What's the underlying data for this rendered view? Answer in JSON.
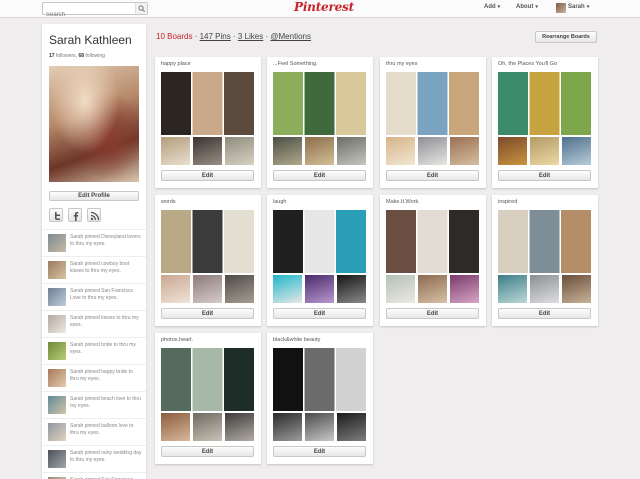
{
  "topbar": {
    "search_placeholder": "Search",
    "logo": "Pinterest",
    "add_label": "Add",
    "about_label": "About",
    "user_label": "Sarah",
    "caret": "▾"
  },
  "profile": {
    "name": "Sarah Kathleen",
    "followers_count": "17",
    "followers_label": "followers,",
    "following_count": "68",
    "following_label": "following",
    "edit_profile_label": "Edit Profile"
  },
  "header": {
    "boards_link": "10 Boards",
    "pins_link": "147 Pins",
    "likes_link": "3 Likes",
    "mentions_link": "@Mentions",
    "separator": "·",
    "rearrange_label": "Rearrange Boards"
  },
  "activity": [
    {
      "text": "Sarah pinned Disneyland lovers to thru my eyes.",
      "colors": [
        "#7d8b8f",
        "#c7b9a6"
      ]
    },
    {
      "text": "Sarah pinned cowboy boot kisses to thru my eyes.",
      "colors": [
        "#9b7b5e",
        "#d8c3a5"
      ]
    },
    {
      "text": "Sarah pinned San Francisco Love to thru my eyes.",
      "colors": [
        "#6d7f95",
        "#c1ccd6"
      ]
    },
    {
      "text": "Sarah pinned kisses to thru my eyes.",
      "colors": [
        "#b3a9a0",
        "#eeeae4"
      ]
    },
    {
      "text": "Sarah pinned bride to thru my eyes.",
      "colors": [
        "#6e8a3a",
        "#b9cc74"
      ]
    },
    {
      "text": "Sarah pinned happy bride to thru my eyes.",
      "colors": [
        "#a57858",
        "#e6ccb0"
      ]
    },
    {
      "text": "Sarah pinned beach love to thru my eyes.",
      "colors": [
        "#5f8b9a",
        "#d3c4a7"
      ]
    },
    {
      "text": "Sarah pinned balloon love to thru my eyes.",
      "colors": [
        "#8f96a0",
        "#e2d3c0"
      ]
    },
    {
      "text": "Sarah pinned rainy wedding day to thru my eyes.",
      "colors": [
        "#4b5057",
        "#a3a7ad"
      ]
    },
    {
      "text": "Sarah pinned San Francisco City H... to thru my eyes.",
      "colors": [
        "#9a8d7c",
        "#dfd6c8"
      ]
    }
  ],
  "boards": [
    {
      "title": "happy place",
      "edit_label": "Edit",
      "cover": [
        "#2c2622",
        "#caa98b",
        "#5b4a3e"
      ],
      "thumbs": [
        [
          "#b49c7c",
          "#e9dfcf"
        ],
        [
          "#3a3430",
          "#9a8f84"
        ],
        [
          "#8e8a7c",
          "#d6d2c4"
        ]
      ]
    },
    {
      "title": "...Feel Something.",
      "edit_label": "Edit",
      "cover": [
        "#8cae5a",
        "#3f6a3c",
        "#d8c89a"
      ],
      "thumbs": [
        [
          "#4a4f45",
          "#b2aa8c"
        ],
        [
          "#8b6e4a",
          "#d3bf97"
        ],
        [
          "#6b6e66",
          "#c6c6bd"
        ]
      ]
    },
    {
      "title": "thru my eyes",
      "edit_label": "Edit",
      "cover": [
        "#e5dccb",
        "#7aa3c2",
        "#c9a67c"
      ],
      "thumbs": [
        [
          "#d7b48a",
          "#f1e6d2"
        ],
        [
          "#8d8f97",
          "#e9e6e1"
        ],
        [
          "#9a7052",
          "#d6bea1"
        ]
      ]
    },
    {
      "title": "Oh, the Places You'll Go",
      "edit_label": "Edit",
      "cover": [
        "#3c8c6b",
        "#c7a33f",
        "#7da74a"
      ],
      "thumbs": [
        [
          "#7b4a2c",
          "#c9933f"
        ],
        [
          "#b39a63",
          "#ecd9a6"
        ],
        [
          "#4d6f8d",
          "#b7ccd9"
        ]
      ]
    },
    {
      "title": "words",
      "edit_label": "Edit",
      "cover": [
        "#b9a987",
        "#3b3b3b",
        "#e4dfd3"
      ],
      "thumbs": [
        [
          "#c9a791",
          "#efe3d7"
        ],
        [
          "#8c7b79",
          "#d6cccb"
        ],
        [
          "#4e4a45",
          "#a69e93"
        ]
      ]
    },
    {
      "title": "laugh",
      "edit_label": "Edit",
      "cover": [
        "#1f1f1f",
        "#e6e6e6",
        "#2b9fb8"
      ],
      "thumbs": [
        [
          "#20b7c9",
          "#e7e7e7"
        ],
        [
          "#4b2a6b",
          "#b999cf"
        ],
        [
          "#161616",
          "#8a8a8a"
        ]
      ]
    },
    {
      "title": "Make.It.Work.",
      "edit_label": "Edit",
      "cover": [
        "#6a4e42",
        "#e2dcd3",
        "#2e2a28"
      ],
      "thumbs": [
        [
          "#b4c2b6",
          "#ece9e1"
        ],
        [
          "#8b6a4f",
          "#d7c1a6"
        ],
        [
          "#7b3a6b",
          "#d6a6c6"
        ]
      ]
    },
    {
      "title": "inspired",
      "edit_label": "Edit",
      "cover": [
        "#d9cfc0",
        "#7d8e96",
        "#b58d67"
      ],
      "thumbs": [
        [
          "#3d7d88",
          "#bdd9d8"
        ],
        [
          "#8b8f94",
          "#dedfe0"
        ],
        [
          "#6a4f3a",
          "#c9b29a"
        ]
      ]
    },
    {
      "title": "photos.heart.",
      "edit_label": "Edit",
      "cover": [
        "#556b5e",
        "#a6b9a6",
        "#1f2d28"
      ],
      "thumbs": [
        [
          "#8a5e3e",
          "#d9b79a"
        ],
        [
          "#6f6a62",
          "#c9c2b6"
        ],
        [
          "#3c3b3a",
          "#b3ada5"
        ]
      ]
    },
    {
      "title": "black&white beauty",
      "edit_label": "Edit",
      "cover": [
        "#111111",
        "#6b6b6b",
        "#d2d2d2"
      ],
      "thumbs": [
        [
          "#2a2a2a",
          "#9b9b9b"
        ],
        [
          "#4a4a4a",
          "#c8c8c8"
        ],
        [
          "#1b1b1b",
          "#7e7e7e"
        ]
      ]
    }
  ]
}
